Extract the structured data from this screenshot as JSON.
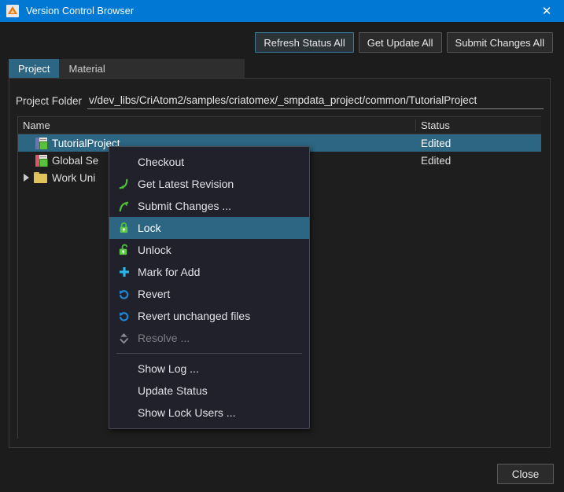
{
  "window": {
    "title": "Version Control Browser",
    "app_icon": "criware-triangle-icon",
    "close_icon": "close-icon",
    "accent_color": "#0078d4",
    "selection_color": "#2c6682"
  },
  "toolbar": {
    "buttons": [
      {
        "label": "Refresh Status All",
        "focused": true
      },
      {
        "label": "Get Update All",
        "focused": false
      },
      {
        "label": "Submit Changes All",
        "focused": false
      }
    ]
  },
  "tabs": [
    {
      "label": "Project",
      "active": true
    },
    {
      "label": "Material",
      "active": false
    }
  ],
  "project_folder": {
    "label": "Project Folder",
    "value": "v/dev_libs/CriAtom2/samples/criatomex/_smpdata_project/common/TutorialProject",
    "placeholder": ""
  },
  "tree": {
    "columns": [
      "Name",
      "Status"
    ],
    "rows": [
      {
        "name": "TutorialProject",
        "status": "Edited",
        "icon": "project-book-icon",
        "icon_color": "#6d73b5",
        "selected": true,
        "expandable": false,
        "indent": 1
      },
      {
        "name": "Global Se",
        "status": "Edited",
        "icon": "settings-book-icon",
        "icon_color": "#d8556a",
        "selected": false,
        "expandable": false,
        "indent": 1
      },
      {
        "name": "Work Uni",
        "status": "",
        "icon": "folder-icon",
        "icon_color": "#e0c35a",
        "selected": false,
        "expandable": true,
        "indent": 0
      }
    ]
  },
  "context_menu": {
    "items": [
      {
        "label": "Checkout",
        "icon": "",
        "state": "normal"
      },
      {
        "label": "Get Latest Revision",
        "icon": "arrow-down-green-icon",
        "state": "normal"
      },
      {
        "label": "Submit Changes ...",
        "icon": "arrow-up-green-icon",
        "state": "normal"
      },
      {
        "label": "Lock",
        "icon": "lock-closed-green-icon",
        "state": "highlighted"
      },
      {
        "label": "Unlock",
        "icon": "lock-open-green-icon",
        "state": "normal"
      },
      {
        "label": "Mark for Add",
        "icon": "plus-cyan-icon",
        "state": "normal"
      },
      {
        "label": "Revert",
        "icon": "revert-blue-icon",
        "state": "normal"
      },
      {
        "label": "Revert unchanged files",
        "icon": "revert-blue-icon",
        "state": "normal"
      },
      {
        "label": "Resolve ...",
        "icon": "resolve-grey-icon",
        "state": "disabled"
      },
      {
        "label": "",
        "icon": "",
        "state": "separator"
      },
      {
        "label": "Show Log ...",
        "icon": "",
        "state": "normal"
      },
      {
        "label": "Update Status",
        "icon": "",
        "state": "normal"
      },
      {
        "label": "Show Lock Users ...",
        "icon": "",
        "state": "normal"
      }
    ]
  },
  "footer": {
    "close_label": "Close"
  }
}
